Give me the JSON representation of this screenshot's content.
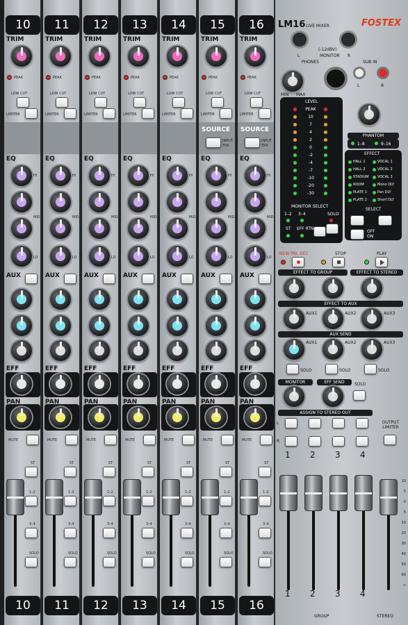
{
  "channels": [
    "10",
    "11",
    "12",
    "13",
    "14",
    "15",
    "16"
  ],
  "strip_labels": {
    "trim": "TRIM",
    "peak": "PEAK",
    "low_cut": "LOW CUT",
    "limiter": "LIMITER",
    "eq": "EQ",
    "hi": "HI",
    "mid": "MID",
    "lo": "LO",
    "aux": "AUX",
    "eff": "EFF",
    "pan": "PAN",
    "mute": "MUTE",
    "st": "ST",
    "one_two": "1–2",
    "three_four": "3–4",
    "solo": "SOLO",
    "source": "SOURCE",
    "input": "INPUT",
    "trk": "TRK"
  },
  "fader_scale": [
    "10",
    "5",
    "0",
    "5",
    "10",
    "20",
    "30",
    "40",
    "50",
    "60",
    "∞"
  ],
  "master": {
    "model": "LM16",
    "live_mixer": "LIVE MIXER",
    "monitor_level": "(-12dBV)",
    "monitor": "MONITOR",
    "l": "L",
    "r": "R",
    "brand": "FOSTEX",
    "phones": "PHONES",
    "sub_in": "SUB IN",
    "min": "MIN",
    "max": "MAX",
    "level": "LEVEL",
    "meter_labels": [
      "PEAK",
      "10",
      "7",
      "4",
      "2",
      "0",
      "-2",
      "-4",
      "-7",
      "-10",
      "-20",
      "-30"
    ],
    "phantom": "PHANTOM",
    "phantom_a": "1–8",
    "phantom_b": "9–16",
    "effect": "EFFECT",
    "effects_left": [
      "HALL 1",
      "HALL 2",
      "STADIUM",
      "ROOM",
      "PLATE 1",
      "PLATE 2"
    ],
    "effects_right": [
      "VOCAL 1",
      "VOCAL 2",
      "VOCAL 3",
      "Mono DLY",
      "Pan DLY",
      "Short DLY"
    ],
    "monitor_select": "MONITOR SELECT",
    "ms_12": "1–2",
    "ms_34": "3–4",
    "ms_solo": "SOLO",
    "ms_st": "ST",
    "ms_effrtn": "EFF RTN",
    "select": "SELECT",
    "off": "OFF",
    "on": "ON",
    "new_pri_rec": "NEW PRI. REC",
    "stop": "STOP",
    "play": "PLAY",
    "effect_to_group": "EFFECT TO GROUP",
    "effect_to_stereo": "EFFECT TO STEREO",
    "effect_to_aux": "EFFECT TO AUX",
    "aux_send": "AUX SEND",
    "aux1": "AUX1",
    "aux2": "AUX2",
    "aux3": "AUX3",
    "monitor_sec": "MONITOR",
    "eff_send": "EFF SEND",
    "assign_to_stereo_out": "ASSIGN TO STEREO OUT",
    "output_limiter": "OUTPUT LIMITER",
    "groups": [
      "1",
      "2",
      "3",
      "4"
    ],
    "group": "GROUP",
    "stereo": "STEREO"
  },
  "colors": {
    "trim_cap": "#f06cc0",
    "eq_cap": "#c9a6f0",
    "aux_cap": "#7fe3f2",
    "eff_cap": "#e8e8e8",
    "pan_cap": "#f3ee6a",
    "brand": "#e23a1c",
    "record_red": "#e02a2a",
    "play_green": "#3bd24a"
  }
}
